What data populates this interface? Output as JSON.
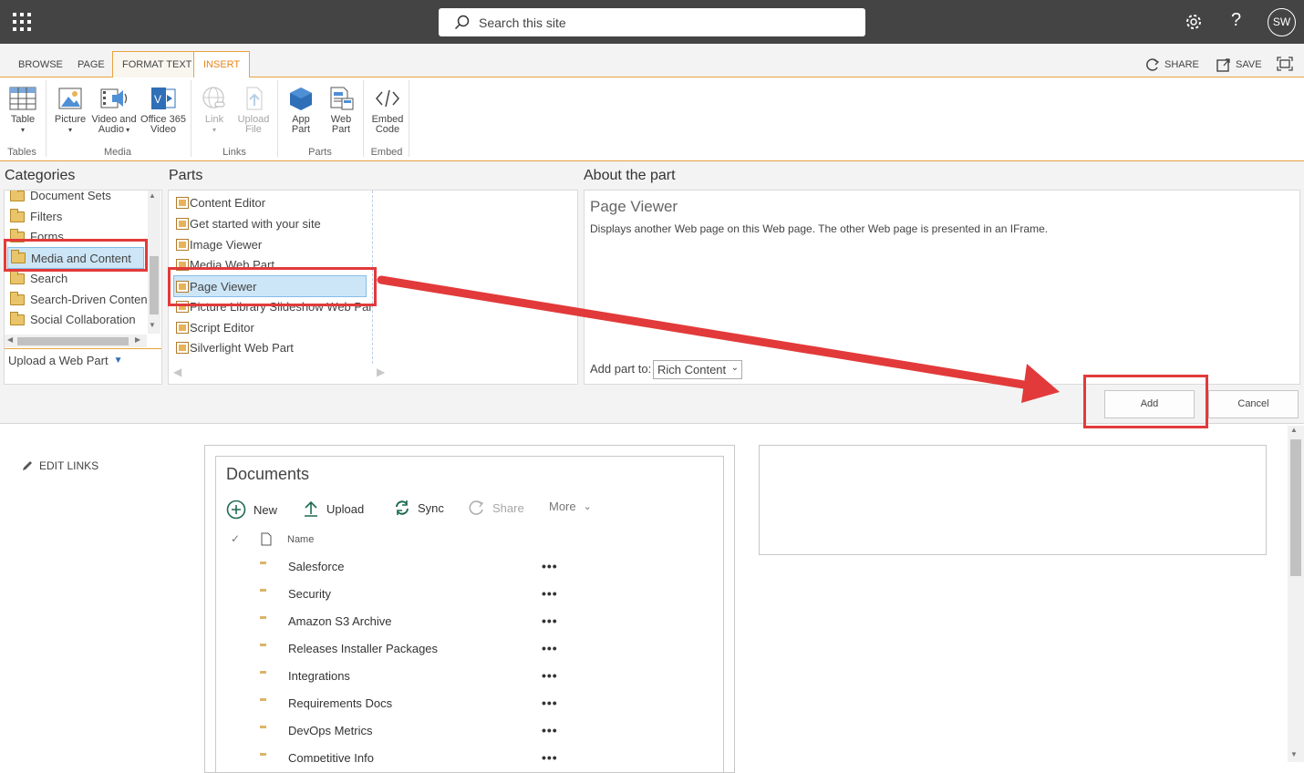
{
  "suitebar": {
    "search_placeholder": "Search this site",
    "user_initials": "SW",
    "help_label": "?"
  },
  "ribbon": {
    "tabs": [
      "BROWSE",
      "PAGE",
      "FORMAT TEXT",
      "INSERT"
    ],
    "selected_tab": "INSERT",
    "right_tools": {
      "share": "SHARE",
      "save": "SAVE"
    },
    "groups": {
      "tables": {
        "label": "Tables",
        "table": "Table"
      },
      "media": {
        "label": "Media",
        "picture": "Picture",
        "video_l1": "Video and",
        "video_l2": "Audio",
        "o365_l1": "Office 365",
        "o365_l2": "Video"
      },
      "links": {
        "label": "Links",
        "link": "Link",
        "upload_l1": "Upload",
        "upload_l2": "File"
      },
      "parts": {
        "label": "Parts",
        "app_l1": "App",
        "app_l2": "Part",
        "web_l1": "Web",
        "web_l2": "Part"
      },
      "embed": {
        "label": "Embed",
        "embed_l1": "Embed",
        "embed_l2": "Code"
      }
    }
  },
  "adder": {
    "categories_title": "Categories",
    "parts_title": "Parts",
    "about_title": "About the part",
    "categories": [
      "Document Sets",
      "Filters",
      "Forms",
      "Media and Content",
      "Search",
      "Search-Driven Content",
      "Social Collaboration"
    ],
    "selected_category": "Media and Content",
    "upload_web_part": "Upload a Web Part",
    "parts": [
      "Content Editor",
      "Get started with your site",
      "Image Viewer",
      "Media Web Part",
      "Page Viewer",
      "Picture Library Slideshow Web Par",
      "Script Editor",
      "Silverlight Web Part"
    ],
    "selected_part": "Page Viewer",
    "about": {
      "name": "Page Viewer",
      "description": "Displays another Web page on this Web page. The other Web page is presented in an IFrame."
    },
    "add_part_to_label": "Add part to:",
    "add_part_to_value": "Rich Content",
    "add_button": "Add",
    "cancel_button": "Cancel"
  },
  "page": {
    "edit_links": "EDIT LINKS",
    "documents": {
      "title": "Documents",
      "commands": {
        "new": "New",
        "upload": "Upload",
        "sync": "Sync",
        "share": "Share",
        "more": "More"
      },
      "column_name": "Name",
      "rows": [
        "Salesforce",
        "Security",
        "Amazon S3 Archive",
        "Releases Installer Packages",
        "Integrations",
        "Requirements Docs",
        "DevOps Metrics",
        "Competitive Info"
      ],
      "row_menu": "•••"
    }
  },
  "colors": {
    "suitebar": "#444444",
    "ribbon_accent": "#e8a33d",
    "highlight_red": "#e23a3a",
    "selection_blue": "#cde6f7"
  }
}
